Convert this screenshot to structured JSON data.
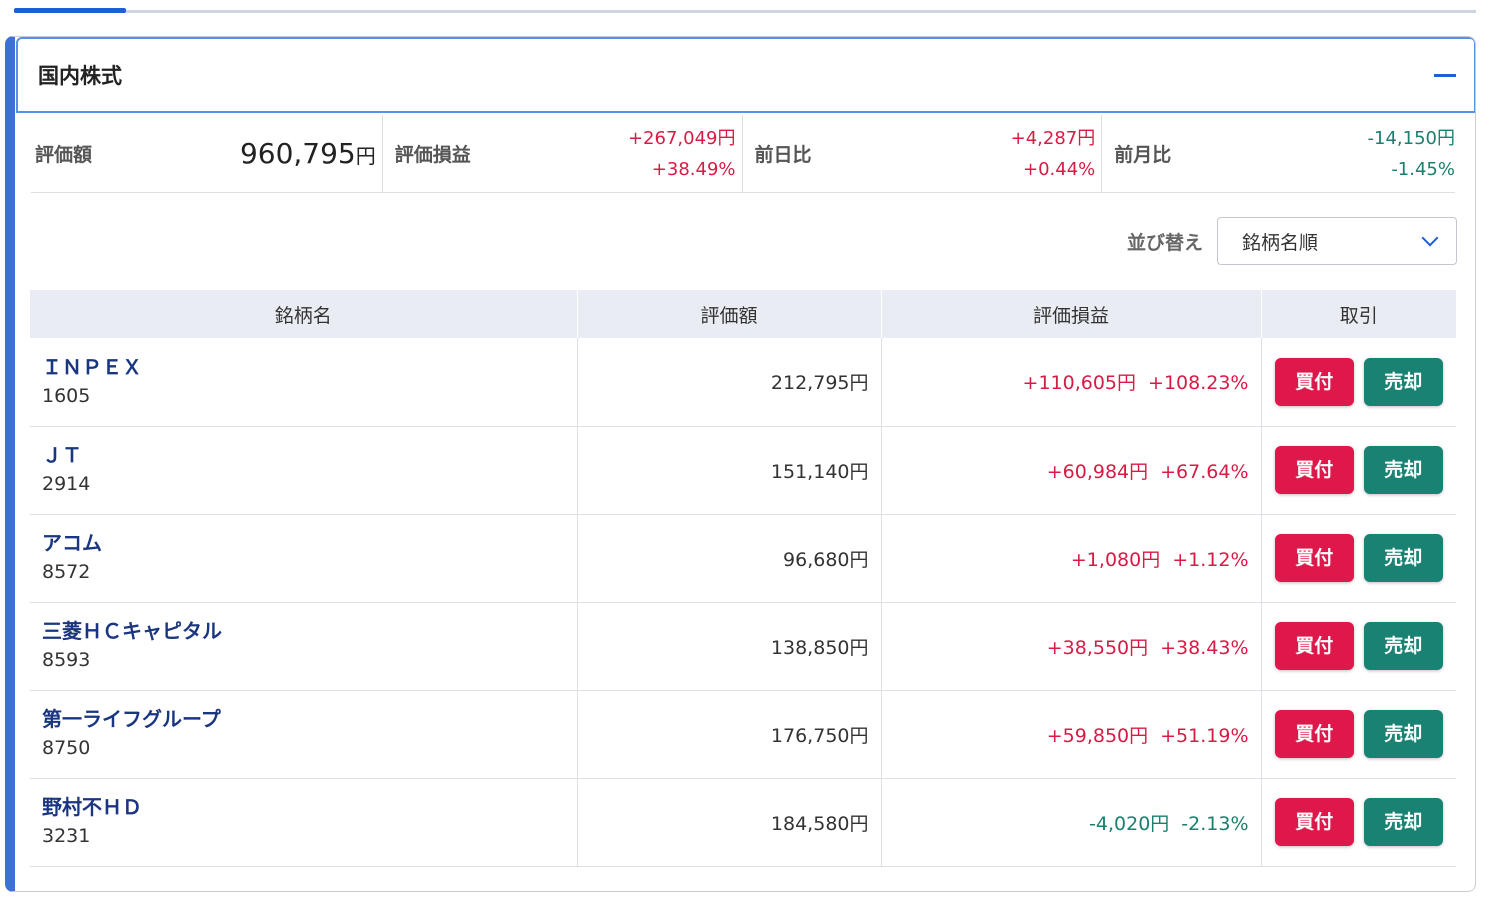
{
  "section": {
    "title": "国内株式"
  },
  "summary": {
    "valuation_label": "評価額",
    "valuation_value": "960,795",
    "valuation_unit": "円",
    "pl_label": "評価損益",
    "pl_amount": "+267,049円",
    "pl_percent": "+38.49%",
    "day_label": "前日比",
    "day_amount": "+4,287円",
    "day_percent": "+0.44%",
    "month_label": "前月比",
    "month_amount": "-14,150円",
    "month_percent": "-1.45%"
  },
  "sort": {
    "label": "並び替え",
    "selected": "銘柄名順"
  },
  "table": {
    "headers": [
      "銘柄名",
      "評価額",
      "評価損益",
      "取引"
    ],
    "buy_label": "買付",
    "sell_label": "売却",
    "rows": [
      {
        "name": "ＩＮＰＥＸ",
        "code": "1605",
        "value": "212,795円",
        "pl_amount": "+110,605円",
        "pl_percent": "+108.23%",
        "trend": "pos"
      },
      {
        "name": "ＪＴ",
        "code": "2914",
        "value": "151,140円",
        "pl_amount": "+60,984円",
        "pl_percent": "+67.64%",
        "trend": "pos"
      },
      {
        "name": "アコム",
        "code": "8572",
        "value": "96,680円",
        "pl_amount": "+1,080円",
        "pl_percent": "+1.12%",
        "trend": "pos"
      },
      {
        "name": "三菱ＨＣキャピタル",
        "code": "8593",
        "value": "138,850円",
        "pl_amount": "+38,550円",
        "pl_percent": "+38.43%",
        "trend": "pos"
      },
      {
        "name": "第一ライフグループ",
        "code": "8750",
        "value": "176,750円",
        "pl_amount": "+59,850円",
        "pl_percent": "+51.19%",
        "trend": "pos"
      },
      {
        "name": "野村不ＨＤ",
        "code": "3231",
        "value": "184,580円",
        "pl_amount": "-4,020円",
        "pl_percent": "-2.13%",
        "trend": "neg"
      }
    ]
  },
  "colors": {
    "positive": "#d81b45",
    "negative": "#1a7f6e",
    "buy": "#e0174b",
    "sell": "#1a8272",
    "accent": "#1f5fd6"
  }
}
